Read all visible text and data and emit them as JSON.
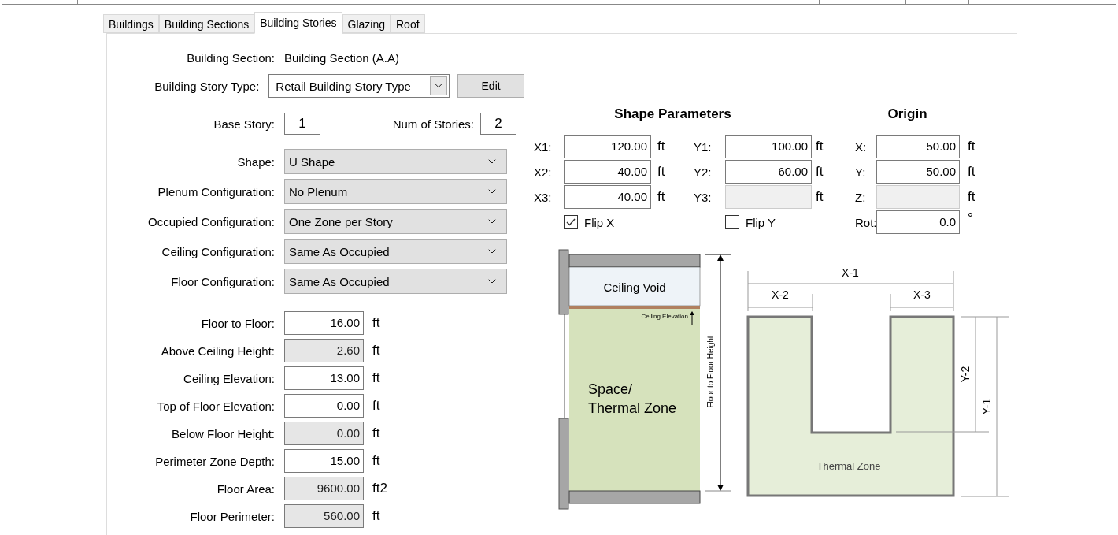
{
  "tabs": [
    {
      "label": "Buildings",
      "selected": false
    },
    {
      "label": "Building Sections",
      "selected": false
    },
    {
      "label": "Building Stories",
      "selected": true
    },
    {
      "label": "Glazing",
      "selected": false
    },
    {
      "label": "Roof",
      "selected": false
    }
  ],
  "building_section": {
    "label": "Building Section:",
    "value": "Building Section (A.A)"
  },
  "story_type": {
    "label": "Building Story Type:",
    "value": "Retail Building Story Type",
    "button": "Edit"
  },
  "base_story": {
    "label": "Base Story:",
    "value": "1"
  },
  "num_stories": {
    "label": "Num of Stories:",
    "value": "2"
  },
  "dropdowns": [
    {
      "label": "Shape:",
      "value": "U Shape"
    },
    {
      "label": "Plenum Configuration:",
      "value": "No Plenum"
    },
    {
      "label": "Occupied Configuration:",
      "value": "One Zone per Story"
    },
    {
      "label": "Ceiling Configuration:",
      "value": "Same As Occupied"
    },
    {
      "label": "Floor Configuration:",
      "value": "Same As Occupied"
    }
  ],
  "measures": [
    {
      "label": "Floor to Floor:",
      "value": "16.00",
      "unit": "ft",
      "readonly": false
    },
    {
      "label": "Above Ceiling Height:",
      "value": "2.60",
      "unit": "ft",
      "readonly": true
    },
    {
      "label": "Ceiling Elevation:",
      "value": "13.00",
      "unit": "ft",
      "readonly": false
    },
    {
      "label": "Top of Floor Elevation:",
      "value": "0.00",
      "unit": "ft",
      "readonly": false
    },
    {
      "label": "Below Floor Height:",
      "value": "0.00",
      "unit": "ft",
      "readonly": true
    },
    {
      "label": "Perimeter Zone Depth:",
      "value": "15.00",
      "unit": "ft",
      "readonly": false
    },
    {
      "label": "Floor Area:",
      "value": "9600.00",
      "unit": "ft2",
      "readonly": true
    },
    {
      "label": "Floor Perimeter:",
      "value": "560.00",
      "unit": "ft",
      "readonly": true
    }
  ],
  "shape_parameters": {
    "title": "Shape Parameters",
    "x_fields": [
      {
        "label": "X1:",
        "value": "120.00",
        "unit": "ft",
        "disabled": false
      },
      {
        "label": "X2:",
        "value": "40.00",
        "unit": "ft",
        "disabled": false
      },
      {
        "label": "X3:",
        "value": "40.00",
        "unit": "ft",
        "disabled": false
      }
    ],
    "y_fields": [
      {
        "label": "Y1:",
        "value": "100.00",
        "unit": "ft",
        "disabled": false
      },
      {
        "label": "Y2:",
        "value": "60.00",
        "unit": "ft",
        "disabled": false
      },
      {
        "label": "Y3:",
        "unit": "ft",
        "disabled": true
      }
    ],
    "flips": [
      {
        "label": "Flip X",
        "checked": true
      },
      {
        "label": "Flip Y",
        "checked": false
      }
    ]
  },
  "origin": {
    "title": "Origin",
    "fields": [
      {
        "label": "X:",
        "value": "50.00",
        "unit": "ft",
        "disabled": false
      },
      {
        "label": "Y:",
        "value": "50.00",
        "unit": "ft",
        "disabled": false
      },
      {
        "label": "Z:",
        "unit": "ft",
        "disabled": true
      },
      {
        "label": "Rot:",
        "value": "0.0",
        "unit": "°",
        "disabled": false
      }
    ]
  },
  "section_diagram": {
    "ceiling_void": "Ceiling Void",
    "ceiling_elevation": "Ceiling Elevation",
    "zone": [
      "Space/",
      "Thermal Zone"
    ],
    "height": "Floor to Floor Height"
  },
  "plan_diagram": {
    "x1": "X-1",
    "x2": "X-2",
    "x3": "X-3",
    "y1": "Y-1",
    "y2": "Y-2",
    "zone": "Thermal Zone"
  }
}
